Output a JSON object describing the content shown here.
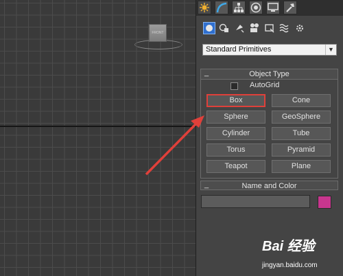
{
  "viewport": {
    "viewcube_label": "FRONT"
  },
  "command_panel": {
    "tabs": [
      {
        "icon": "create-icon",
        "active": true
      },
      {
        "icon": "modify-icon",
        "active": false
      },
      {
        "icon": "hierarchy-icon",
        "active": false
      },
      {
        "icon": "motion-icon",
        "active": false
      },
      {
        "icon": "display-icon",
        "active": false
      },
      {
        "icon": "utilities-icon",
        "active": false
      }
    ],
    "categories": [
      "geometry-icon",
      "shapes-icon",
      "lights-icon",
      "cameras-icon",
      "helpers-icon",
      "space-warps-icon",
      "systems-icon"
    ],
    "dropdown": {
      "selected": "Standard Primitives"
    },
    "object_type": {
      "title": "Object Type",
      "collapse": "_",
      "autogrid_label": "AutoGrid",
      "buttons": [
        {
          "label": "Box",
          "highlighted": true
        },
        {
          "label": "Cone"
        },
        {
          "label": "Sphere"
        },
        {
          "label": "GeoSphere"
        },
        {
          "label": "Cylinder"
        },
        {
          "label": "Tube"
        },
        {
          "label": "Torus"
        },
        {
          "label": "Pyramid"
        },
        {
          "label": "Teapot"
        },
        {
          "label": "Plane"
        }
      ]
    },
    "name_color": {
      "title": "Name and Color",
      "collapse": "_",
      "name_value": "",
      "color": "#c8368e"
    }
  },
  "annotation": {
    "arrow_color": "#e0403a"
  },
  "watermark": {
    "logo": "Bai 经验",
    "url": "jingyan.baidu.com"
  }
}
